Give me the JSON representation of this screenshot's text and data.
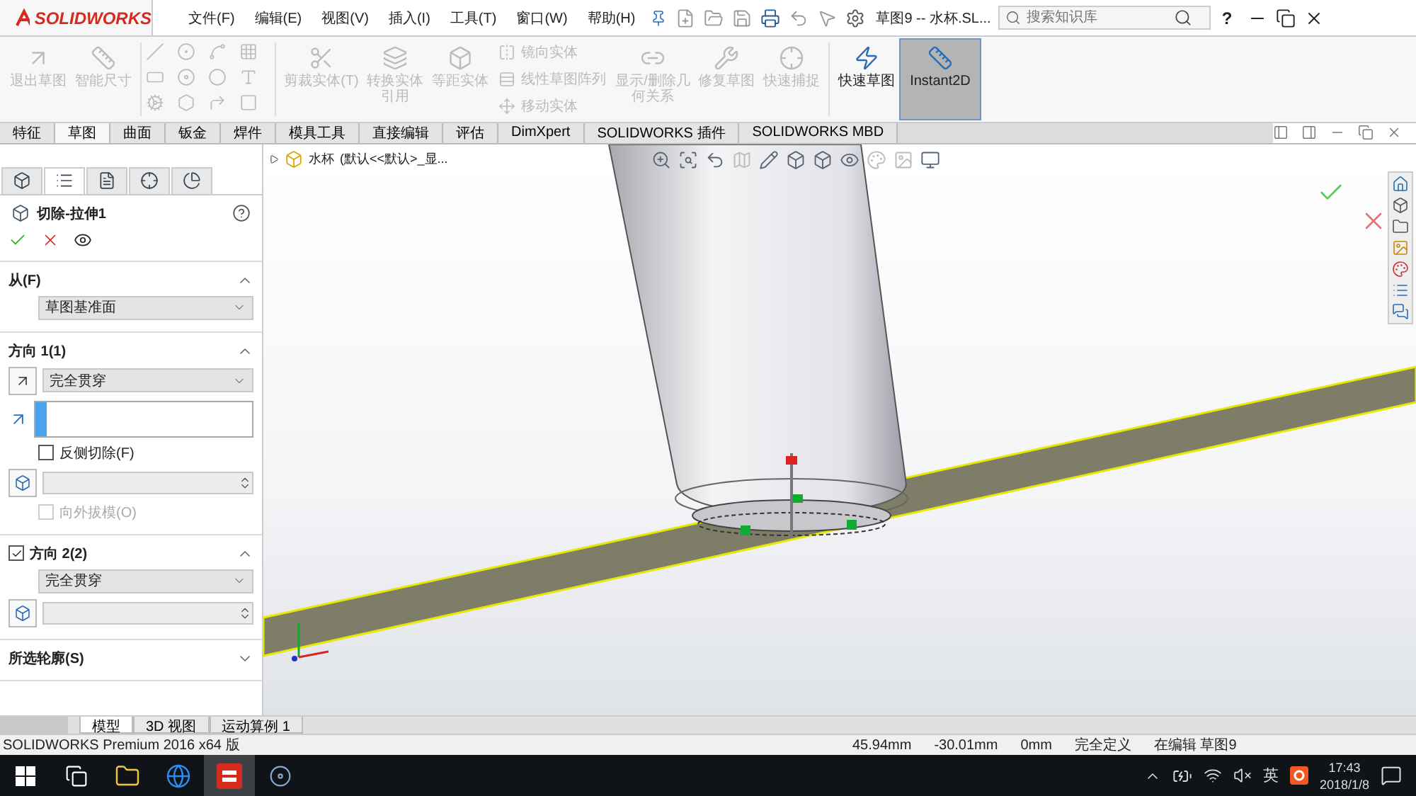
{
  "app": {
    "logo": "SOLIDWORKS"
  },
  "menu": [
    "文件(F)",
    "编辑(E)",
    "视图(V)",
    "插入(I)",
    "工具(T)",
    "窗口(W)",
    "帮助(H)"
  ],
  "title": "草图9 -- 水杯.SL...",
  "search": {
    "placeholder": "搜索知识库"
  },
  "help": "?",
  "ribbon": [
    {
      "kind": "large",
      "label": "退出草图",
      "disabled": true,
      "selected": false
    },
    {
      "kind": "large",
      "label": "智能尺寸",
      "disabled": true,
      "selected": false
    },
    {
      "kind": "grid"
    },
    {
      "kind": "large",
      "label": "剪裁实体(T)",
      "disabled": true,
      "selected": false
    },
    {
      "kind": "large",
      "label": "转换实体引用",
      "disabled": true,
      "selected": false
    },
    {
      "kind": "large",
      "label": "等距实体",
      "disabled": true,
      "selected": false
    },
    {
      "kind": "list",
      "items": [
        {
          "label": "镜向实体",
          "disabled": true
        },
        {
          "label": "线性草图阵列",
          "disabled": true
        },
        {
          "label": "移动实体",
          "disabled": true
        }
      ]
    },
    {
      "kind": "large",
      "label": "显示/删除几何关系",
      "disabled": true,
      "selected": false
    },
    {
      "kind": "large",
      "label": "修复草图",
      "disabled": true,
      "selected": false
    },
    {
      "kind": "large",
      "label": "快速捕捉",
      "disabled": true,
      "selected": false
    },
    {
      "kind": "large",
      "label": "快速草图",
      "disabled": false,
      "selected": false
    },
    {
      "kind": "large",
      "label": "Instant2D",
      "disabled": false,
      "selected": true
    }
  ],
  "tabs": [
    {
      "label": "特征",
      "selected": false
    },
    {
      "label": "草图",
      "selected": true
    },
    {
      "label": "曲面",
      "selected": false
    },
    {
      "label": "钣金",
      "selected": false
    },
    {
      "label": "焊件",
      "selected": false
    },
    {
      "label": "模具工具",
      "selected": false
    },
    {
      "label": "直接编辑",
      "selected": false
    },
    {
      "label": "评估",
      "selected": false
    },
    {
      "label": "DimXpert",
      "selected": false
    },
    {
      "label": "SOLIDWORKS 插件",
      "selected": false
    },
    {
      "label": "SOLIDWORKS MBD",
      "selected": false
    }
  ],
  "feature_panel": {
    "tabs": [
      {
        "selected": false
      },
      {
        "selected": true
      },
      {
        "selected": false
      },
      {
        "selected": false
      },
      {
        "selected": false
      }
    ],
    "title": "切除-拉伸1",
    "sections": [
      {
        "label": "从(F)",
        "expanded": true,
        "items": [
          {
            "kind": "dropdown",
            "value": "草图基准面"
          }
        ]
      },
      {
        "label": "方向 1(1)",
        "expanded": true,
        "items": [
          {
            "kind": "dropdown",
            "value": "完全贯穿",
            "icon": true
          },
          {
            "kind": "select_box"
          },
          {
            "kind": "checkbox",
            "label": "反侧切除(F)",
            "checked": false,
            "disabled": false
          },
          {
            "kind": "spin"
          },
          {
            "kind": "checkbox",
            "label": "向外拔模(O)",
            "checked": false,
            "disabled": true
          }
        ]
      },
      {
        "label": "方向 2(2)",
        "checked": true,
        "expanded": true,
        "items": [
          {
            "kind": "dropdown",
            "value": "完全贯穿",
            "icon": false
          },
          {
            "kind": "spin"
          }
        ]
      },
      {
        "label": "所选轮廓(S)",
        "expanded": false
      }
    ]
  },
  "model_tree": {
    "name": "水杯",
    "config": "(默认<<默认>_显..."
  },
  "bottom_tabs": [
    {
      "label": "模型",
      "selected": true
    },
    {
      "label": "3D 视图",
      "selected": false
    },
    {
      "label": "运动算例 1",
      "selected": false
    }
  ],
  "status": {
    "product": "SOLIDWORKS Premium 2016 x64 版",
    "fields": [
      "45.94mm",
      "-30.01mm",
      "0mm",
      "完全定义",
      "在编辑 草图9"
    ]
  },
  "taskbar": {
    "apps": [
      {
        "kind": "task_view",
        "selected": false
      },
      {
        "kind": "explorer",
        "selected": false
      },
      {
        "kind": "browser",
        "selected": false
      },
      {
        "kind": "solidworks",
        "selected": true
      },
      {
        "kind": "other",
        "selected": false
      }
    ],
    "ime": "英",
    "time": "17:43",
    "date": "2018/1/8"
  }
}
